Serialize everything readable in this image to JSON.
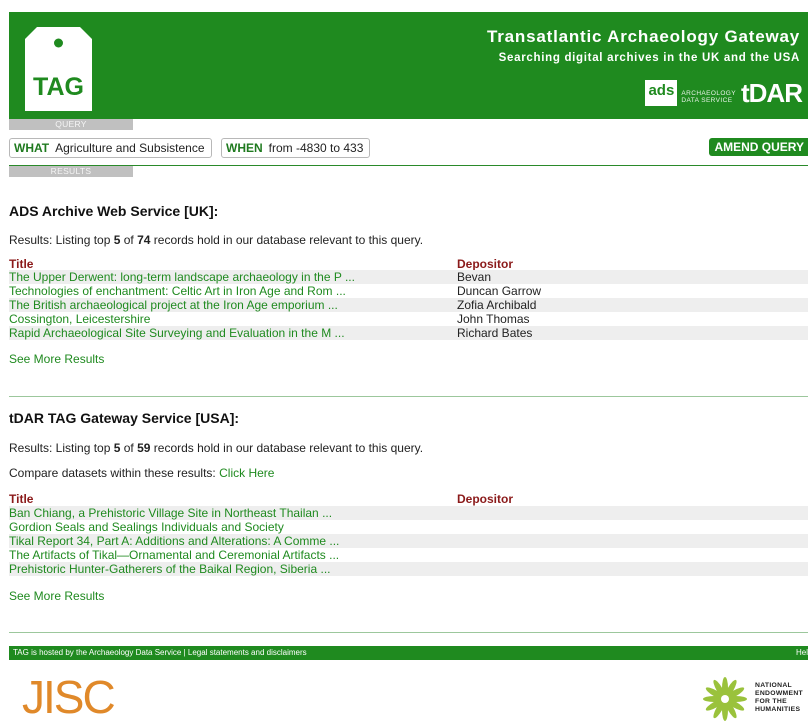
{
  "header": {
    "logo_text": "TAG",
    "title": "Transatlantic Archaeology Gateway",
    "subtitle": "Searching digital archives in the UK and the USA",
    "ads_logo": "ads",
    "ads_text_line1": "ARCHAEOLOGY",
    "ads_text_line2": "DATA SERVICE",
    "tdar_logo": "tDAR"
  },
  "query_tab": "QUERY",
  "results_tab": "RESULTS",
  "query": {
    "what_label": "WHAT",
    "what_value": "Agriculture and Subsistence",
    "when_label": "WHEN",
    "when_value": "from -4830 to 433",
    "amend_label": "AMEND QUERY"
  },
  "ads_section": {
    "title": "ADS Archive Web Service [UK]:",
    "summary_pre": "Results: Listing top ",
    "shown": "5",
    "summary_mid": " of ",
    "total": "74",
    "summary_post": " records hold in our database relevant to this query.",
    "col_title": "Title",
    "col_depositor": "Depositor",
    "rows": [
      {
        "title": "The Upper Derwent: long-term landscape archaeology in the P ...",
        "depositor": "Bevan"
      },
      {
        "title": "Technologies of enchantment: Celtic Art in Iron Age and Rom ...",
        "depositor": "Duncan Garrow"
      },
      {
        "title": "The British archaeological project at the Iron Age emporium ...",
        "depositor": "Zofia Archibald"
      },
      {
        "title": "Cossington, Leicestershire",
        "depositor": "John Thomas"
      },
      {
        "title": "Rapid Archaeological Site Surveying and Evaluation in the M ...",
        "depositor": "Richard Bates"
      }
    ],
    "see_more": "See More Results"
  },
  "tdar_section": {
    "title": "tDAR TAG Gateway Service [USA]:",
    "summary_pre": "Results: Listing top ",
    "shown": "5",
    "summary_mid": " of ",
    "total": "59",
    "summary_post": " records hold in our database relevant to this query.",
    "compare_text": "Compare datasets within these results: ",
    "compare_link": "Click Here",
    "col_title": "Title",
    "col_depositor": "Depositor",
    "rows": [
      {
        "title": "Ban Chiang, a Prehistoric Village Site in Northeast Thailan ...",
        "depositor": ""
      },
      {
        "title": "Gordion Seals and Sealings Individuals and Society",
        "depositor": ""
      },
      {
        "title": "Tikal Report 34, Part A: Additions and Alterations: A Comme ...",
        "depositor": ""
      },
      {
        "title": "The Artifacts of Tikal—Ornamental and Ceremonial Artifacts ...",
        "depositor": ""
      },
      {
        "title": "Prehistoric Hunter-Gatherers of the Baikal Region, Siberia ...",
        "depositor": ""
      }
    ],
    "see_more": "See More Results"
  },
  "footer": {
    "left_text": "TAG is hosted by the Archaeology Data Service | Legal statements and disclaimers",
    "right_text": "Hel",
    "jisc": "JISC",
    "neh_line1": "NATIONAL",
    "neh_line2": "ENDOWMENT",
    "neh_line3": "FOR THE",
    "neh_line4": "HUMANITIES"
  },
  "colors": {
    "brand_green": "#1f8a1f",
    "header_title_red": "#8b1a1a",
    "row_shade": "#eeeeee"
  }
}
